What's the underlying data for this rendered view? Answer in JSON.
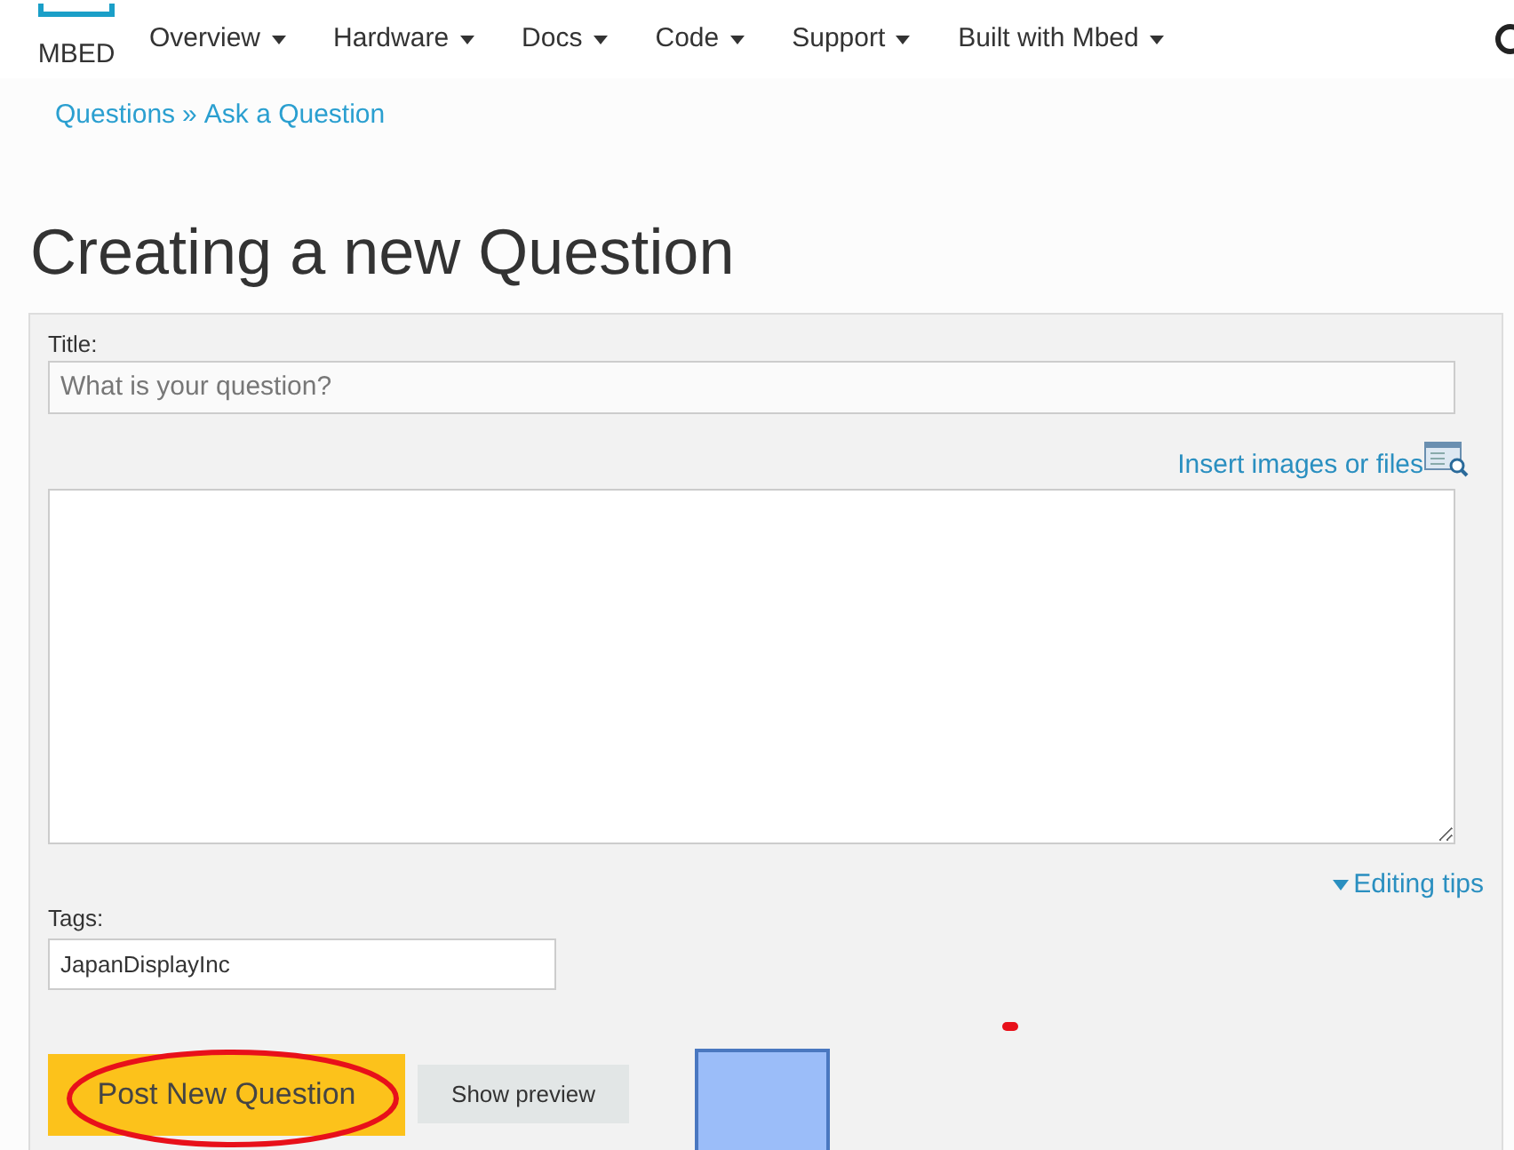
{
  "logo": {
    "text": "MBED"
  },
  "nav": [
    {
      "label": "Overview"
    },
    {
      "label": "Hardware"
    },
    {
      "label": "Docs"
    },
    {
      "label": "Code"
    },
    {
      "label": "Support"
    },
    {
      "label": "Built with Mbed"
    }
  ],
  "breadcrumb": {
    "parent": "Questions",
    "separator": "»",
    "current": "Ask a Question"
  },
  "heading": "Creating a new Question",
  "form": {
    "title_label": "Title:",
    "title_placeholder": "What is your question?",
    "insert_link": "Insert images or files",
    "editing_tips": "Editing tips",
    "tags_label": "Tags:",
    "tags_value": "JapanDisplayInc",
    "post_button": "Post New Question",
    "preview_button": "Show preview"
  }
}
